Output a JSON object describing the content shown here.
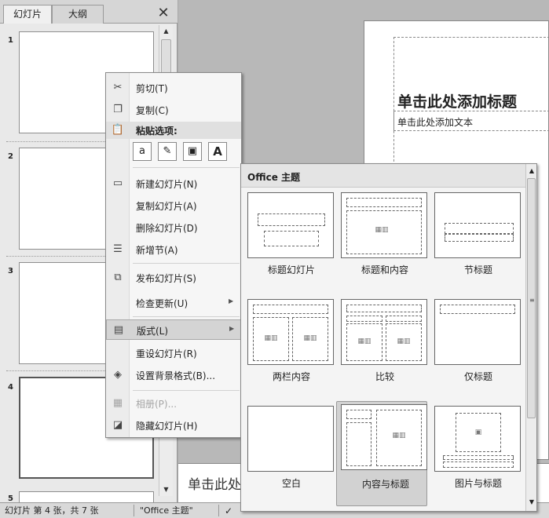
{
  "panel": {
    "tabs": [
      "幻灯片",
      "大纲"
    ],
    "close_icon": "close-icon",
    "slide_numbers": [
      "1",
      "2",
      "3",
      "4",
      "5"
    ]
  },
  "slide": {
    "title": "单击此处添加标题",
    "body": "单击此处添加文本"
  },
  "notes": {
    "text": "单击此处"
  },
  "statusbar": {
    "slide_info": "幻灯片 第 4 张，共 7 张",
    "theme": "\"Office 主题\""
  },
  "context_menu": {
    "items": [
      {
        "label": "剪切(T)",
        "icon": "scissors-icon"
      },
      {
        "label": "复制(C)",
        "icon": "copy-icon"
      },
      {
        "label": "粘贴选项:",
        "icon": "paste-icon"
      },
      {
        "label": "新建幻灯片(N)",
        "icon": "new-slide-icon"
      },
      {
        "label": "复制幻灯片(A)",
        "icon": ""
      },
      {
        "label": "删除幻灯片(D)",
        "icon": ""
      },
      {
        "label": "新增节(A)",
        "icon": "section-icon"
      },
      {
        "label": "发布幻灯片(S)",
        "icon": "publish-icon"
      },
      {
        "label": "检查更新(U)",
        "icon": ""
      },
      {
        "label": "版式(L)",
        "icon": "layout-icon"
      },
      {
        "label": "重设幻灯片(R)",
        "icon": ""
      },
      {
        "label": "设置背景格式(B)...",
        "icon": "background-icon"
      },
      {
        "label": "相册(P)...",
        "icon": "album-icon"
      },
      {
        "label": "隐藏幻灯片(H)",
        "icon": "hide-slide-icon"
      }
    ],
    "paste_options": [
      "a",
      "✎",
      "▣",
      "A"
    ]
  },
  "gallery": {
    "title": "Office 主题",
    "layouts": [
      "标题幻灯片",
      "标题和内容",
      "节标题",
      "两栏内容",
      "比较",
      "仅标题",
      "空白",
      "内容与标题",
      "图片与标题"
    ],
    "selected": "内容与标题"
  }
}
